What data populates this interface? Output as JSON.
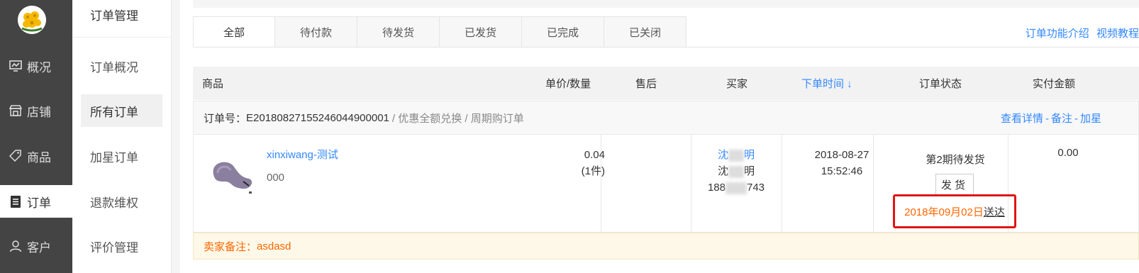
{
  "leftnav": {
    "items": [
      {
        "label": "概况",
        "icon": "overview-icon"
      },
      {
        "label": "店铺",
        "icon": "shop-icon"
      },
      {
        "label": "商品",
        "icon": "tag-icon"
      },
      {
        "label": "订单",
        "icon": "order-icon"
      },
      {
        "label": "客户",
        "icon": "user-icon"
      }
    ]
  },
  "subnav": {
    "title": "订单管理",
    "items": [
      {
        "label": "订单概况"
      },
      {
        "label": "所有订单"
      },
      {
        "label": "加星订单"
      },
      {
        "label": "退款维权"
      },
      {
        "label": "评价管理"
      }
    ]
  },
  "tabs": [
    "全部",
    "待付款",
    "待发货",
    "已发货",
    "已完成",
    "已关闭"
  ],
  "help_links": [
    "订单功能介绍",
    "视频教程"
  ],
  "table_headers": {
    "product": "商品",
    "price_qty": "单价/数量",
    "after_sale": "售后",
    "buyer": "买家",
    "order_time": "下单时间 ↓",
    "status": "订单状态",
    "paid": "实付金额"
  },
  "order": {
    "number_label": "订单号：",
    "number": "E20180827155246044900001",
    "tags": "/ 优惠全额兑换 / 周期购订单",
    "actions": [
      "查看详情",
      "备注",
      "加星"
    ],
    "action_sep": "-",
    "product_name": "xinxiwang-测试",
    "product_spec": "000",
    "unit_price": "0.04",
    "quantity": "(1件)",
    "buyer_name_1": "沈",
    "buyer_name_1b": "明",
    "buyer_name_2": "沈",
    "buyer_name_2b": "明",
    "buyer_phone_a": "188",
    "buyer_phone_b": "743",
    "time_date": "2018-08-27",
    "time_clock": "15:52:46",
    "status_text": "第2期待发货",
    "ship_button": "发货",
    "delivery_date": "2018年09月02日",
    "delivery_suffix": "送达",
    "paid_amount": "0.00"
  },
  "remark": {
    "label": "卖家备注：",
    "value": "asdasd"
  },
  "colors": {
    "accent": "#3388ff",
    "nav_bg": "#444444",
    "orange": "#ff6600",
    "highlight_border": "#e01515"
  }
}
